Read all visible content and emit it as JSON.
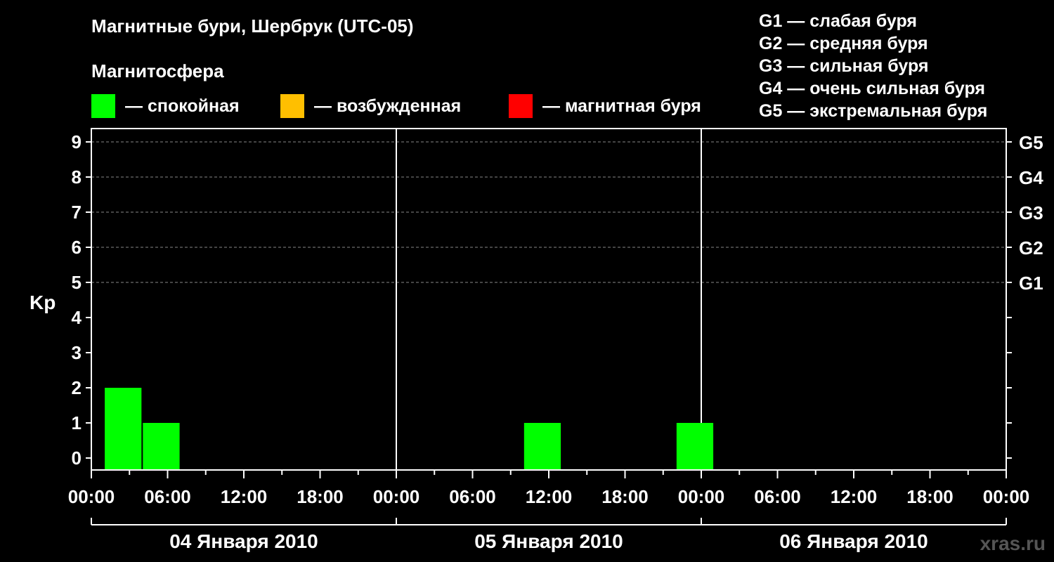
{
  "header": {
    "title": "Магнитные бури, Шербрук (UTC-05)",
    "subtitle": "Магнитосфера"
  },
  "legend": [
    {
      "label": "— спокойная",
      "color": "#00ff00"
    },
    {
      "label": "— возбужденная",
      "color": "#ffbf00"
    },
    {
      "label": "— магнитная буря",
      "color": "#ff0000"
    }
  ],
  "storm_levels": [
    "G1 — слабая буря",
    "G2 — средняя буря",
    "G3 — сильная буря",
    "G4 — очень сильная буря",
    "G5 — экстремальная буря"
  ],
  "watermark": "xras.ru",
  "chart_data": {
    "type": "bar",
    "title": "Магнитные бури, Шербрук (UTC-05)",
    "ylabel": "Kp",
    "ylim": [
      0,
      9
    ],
    "yticks": [
      "0",
      "1",
      "2",
      "3",
      "4",
      "5",
      "6",
      "7",
      "8",
      "9"
    ],
    "right_ticks": [
      {
        "kp": 5,
        "label": "G1"
      },
      {
        "kp": 6,
        "label": "G2"
      },
      {
        "kp": 7,
        "label": "G3"
      },
      {
        "kp": 8,
        "label": "G4"
      },
      {
        "kp": 9,
        "label": "G5"
      }
    ],
    "grid": "dashed horizontal at Kp 5-9",
    "xlim_hours": [
      0,
      72
    ],
    "x_tick_labels": [
      "00:00",
      "06:00",
      "12:00",
      "18:00",
      "00:00",
      "06:00",
      "12:00",
      "18:00",
      "00:00",
      "06:00",
      "12:00",
      "18:00",
      "00:00"
    ],
    "days": [
      "04 Января 2010",
      "05 Января 2010",
      "06 Января 2010"
    ],
    "colors": {
      "quiet": "#00ff00",
      "active": "#ffbf00",
      "storm": "#ff0000"
    },
    "bars": [
      {
        "start_hour": 1,
        "end_hour": 4,
        "kp": 2,
        "state": "quiet"
      },
      {
        "start_hour": 4,
        "end_hour": 7,
        "kp": 1,
        "state": "quiet"
      },
      {
        "start_hour": 34,
        "end_hour": 37,
        "kp": 1,
        "state": "quiet"
      },
      {
        "start_hour": 46,
        "end_hour": 49,
        "kp": 1,
        "state": "quiet"
      }
    ]
  }
}
